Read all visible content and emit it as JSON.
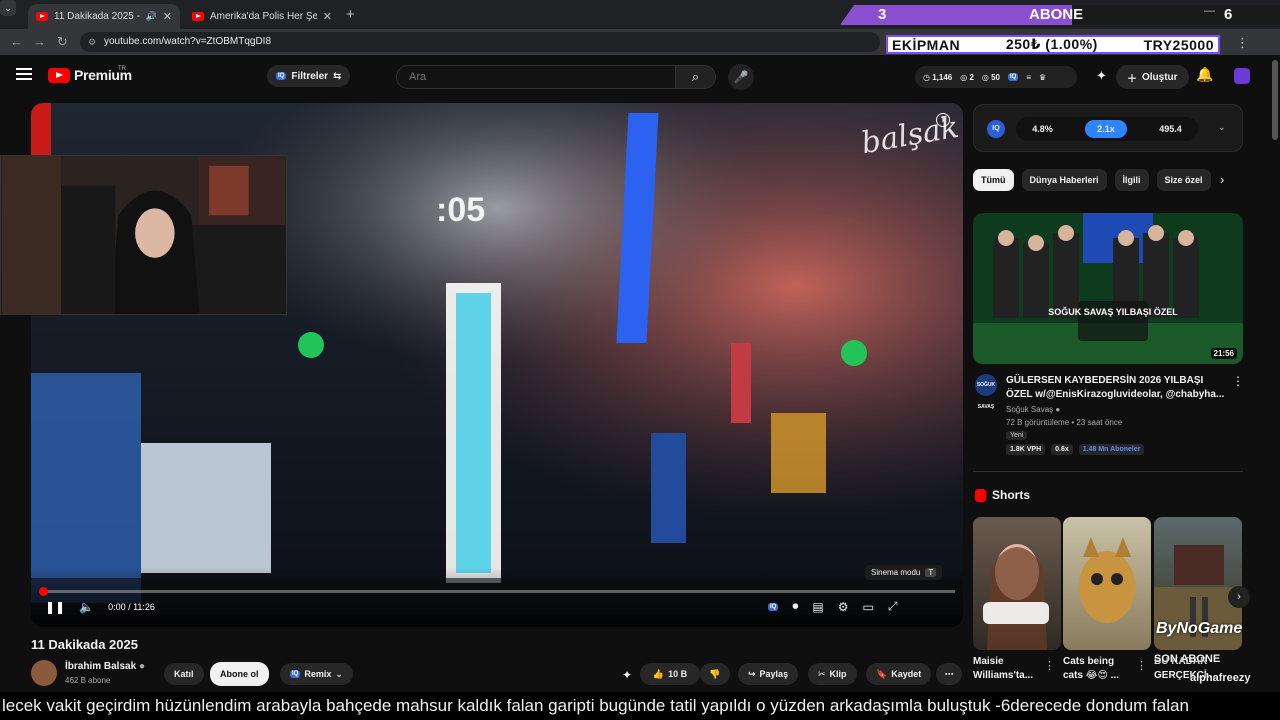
{
  "browser": {
    "tabs": [
      {
        "label": "11 Dakikada 2025 - YouTube",
        "active": true
      },
      {
        "label": "Amerika'da Polis Her Şeyi Görüyor",
        "active": false
      }
    ],
    "url": "youtube.com/watch?v=ZtOBMTqgDI8"
  },
  "stream_overlay": {
    "abone_count": "3",
    "abone_label": "ABONE",
    "abone_goal": "6",
    "ekipman_label": "EKİPMAN",
    "ekipman_progress": "250₺ (1.00%)",
    "ekipman_goal": "TRY25000",
    "bynogame": "ByNoGame",
    "son_abone_label": "SON ABONE",
    "son_abone_name": "alphafreezy",
    "subtitle": "lecek vakit geçirdim hüzünlendim arabayla bahçede mahsur kaldık falan garipti bugünde tatil yapıldı o yüzden arkadaşımla buluştuk -6derecede dondum falan"
  },
  "header": {
    "logo_text": "Premium",
    "region": "TR",
    "filter_label": "Filtreler",
    "search_placeholder": "Ara",
    "stats": {
      "time": "1,146",
      "eye": "2",
      "watch": "50"
    },
    "create_label": "Oluştur"
  },
  "player": {
    "current_time": "0:00",
    "duration": "11:26",
    "time_display": "0:00 / 11:26",
    "progress_fraction": 0.003,
    "watermark": "balşak",
    "cinema_tip": "Sinema modu",
    "cinema_key": "T"
  },
  "video": {
    "title": "11 Dakikada 2025",
    "channel": "İbrahim Balsak",
    "subscribers": "462 B abone",
    "join_label": "Katıl",
    "subscribe_label": "Abone ol",
    "remix_label": "Remix",
    "likes": "10 B",
    "share_label": "Paylaş",
    "clip_label": "Klip",
    "save_label": "Kaydet"
  },
  "extension_panel": {
    "values": [
      "4.8%",
      "2.1x",
      "495.4"
    ],
    "active_index": 1
  },
  "chips": [
    "Tümü",
    "Dünya Haberleri",
    "İlgili",
    "Size özel"
  ],
  "recommendation": {
    "title": "GÜLERSEN KAYBEDERSİN 2026 YILBAŞI ÖZEL w/@EnisKirazogluvideolar, @chabyha...",
    "channel": "Soğuk Savaş",
    "meta": "72 B görüntüleme • 23 saat önce",
    "badge": "Yeni",
    "duration": "21:56",
    "thumb_text": "SOĞUK SAVAŞ YILBAŞI ÖZEL",
    "channel_icon_text": "SOĞUK SAVAŞ",
    "tags": [
      "1.8K VPH",
      "0.6x",
      "1.48 Mn Aboneler"
    ]
  },
  "shorts": {
    "heading": "Shorts",
    "items": [
      {
        "title": "Maisie Williams'ta..."
      },
      {
        "title": "Cats being cats 😂😍 ..."
      },
      {
        "title": "BU KADAR GERÇEKÇİ..."
      }
    ]
  },
  "colors": {
    "accent_red": "#ff0000",
    "banner_purple": "#8a4fd1",
    "ext_blue": "#2d86ff"
  }
}
